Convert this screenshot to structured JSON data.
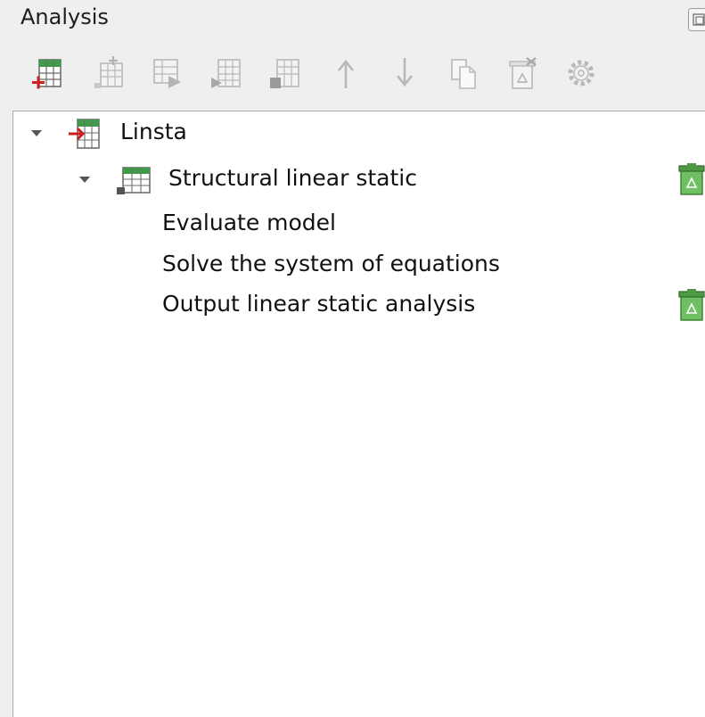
{
  "panel": {
    "title": "Analysis"
  },
  "toolbar": {
    "tools": [
      {
        "name": "new-analysis-icon",
        "enabled": true
      },
      {
        "name": "add-step-icon",
        "enabled": false
      },
      {
        "name": "add-command-icon",
        "enabled": false
      },
      {
        "name": "run-icon",
        "enabled": false
      },
      {
        "name": "stop-icon",
        "enabled": false
      },
      {
        "name": "move-up-icon",
        "enabled": false
      },
      {
        "name": "move-down-icon",
        "enabled": false
      },
      {
        "name": "copy-icon",
        "enabled": false
      },
      {
        "name": "delete-icon",
        "enabled": false
      },
      {
        "name": "settings-icon",
        "enabled": false
      }
    ]
  },
  "tree": {
    "nodes": [
      {
        "label": "Linsta",
        "level": 0,
        "expanded": true,
        "icon": "analysis-icon"
      },
      {
        "label": "Structural linear static",
        "level": 1,
        "expanded": true,
        "icon": "step-icon",
        "status_icon": "recycle-bin-icon"
      },
      {
        "label": "Evaluate model",
        "level": 2
      },
      {
        "label": "Solve the system of equations",
        "level": 2
      },
      {
        "label": "Output linear static analysis",
        "level": 2,
        "status_icon": "recycle-bin-icon"
      }
    ]
  },
  "colors": {
    "accent_green": "#3f9a4a",
    "accent_red": "#cc1f1f",
    "disabled_gray": "#b8b8b8"
  }
}
